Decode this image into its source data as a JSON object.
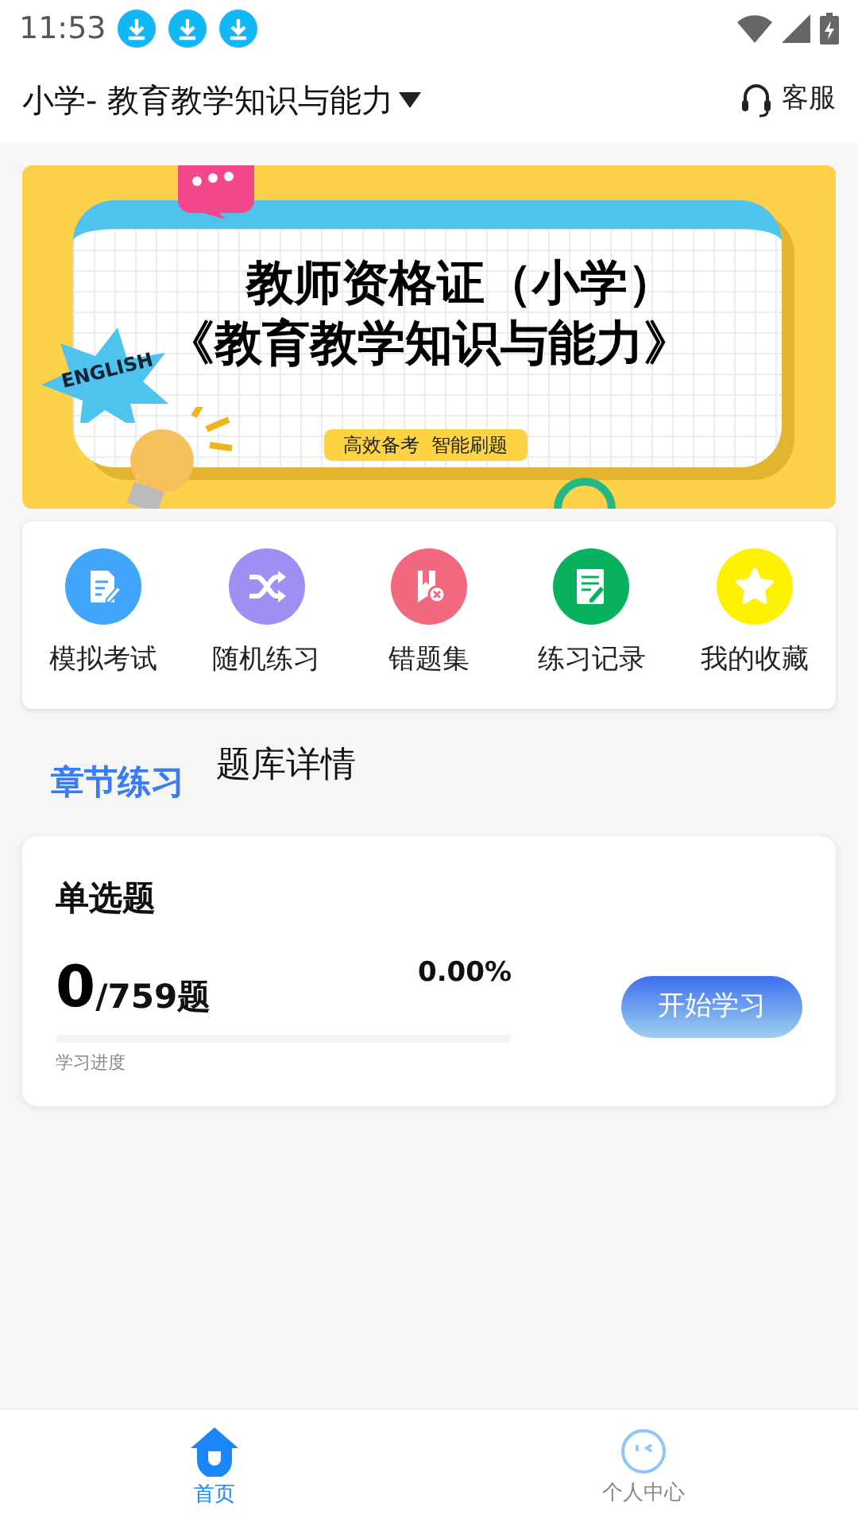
{
  "status_bar": {
    "time": "11:53"
  },
  "header": {
    "title": "小学- 教育教学知识与能力",
    "service": "客服"
  },
  "banner": {
    "line_1": "教师资格证（小学）",
    "line_2": "《教育教学知识与能力》",
    "sticker": "ENGLISH",
    "tagline": "高效备考  智能刷题"
  },
  "shortcuts": [
    {
      "label": "模拟考试",
      "color": "#42a5fc",
      "kind": "exam"
    },
    {
      "label": "随机练习",
      "color": "#a08ff3",
      "kind": "random"
    },
    {
      "label": "错题集",
      "color": "#f1687f",
      "kind": "wrong"
    },
    {
      "label": "练习记录",
      "color": "#08b15e",
      "kind": "record"
    },
    {
      "label": "我的收藏",
      "color": "#fef102",
      "kind": "favorite"
    }
  ],
  "tabs": [
    {
      "label": "章节练习",
      "selected": true
    },
    {
      "label": "题库详情",
      "selected": false
    }
  ],
  "practice_card": {
    "title": "单选题",
    "done": "0",
    "total": "/759题",
    "percent": "0.00%",
    "progress": {
      "level": 0
    },
    "progress_label": "学习进度",
    "button": "开始学习"
  },
  "bottom_nav": [
    {
      "label": "首页",
      "selected": true,
      "kind": "home"
    },
    {
      "label": "个人中心",
      "selected": false,
      "kind": "profile"
    }
  ]
}
